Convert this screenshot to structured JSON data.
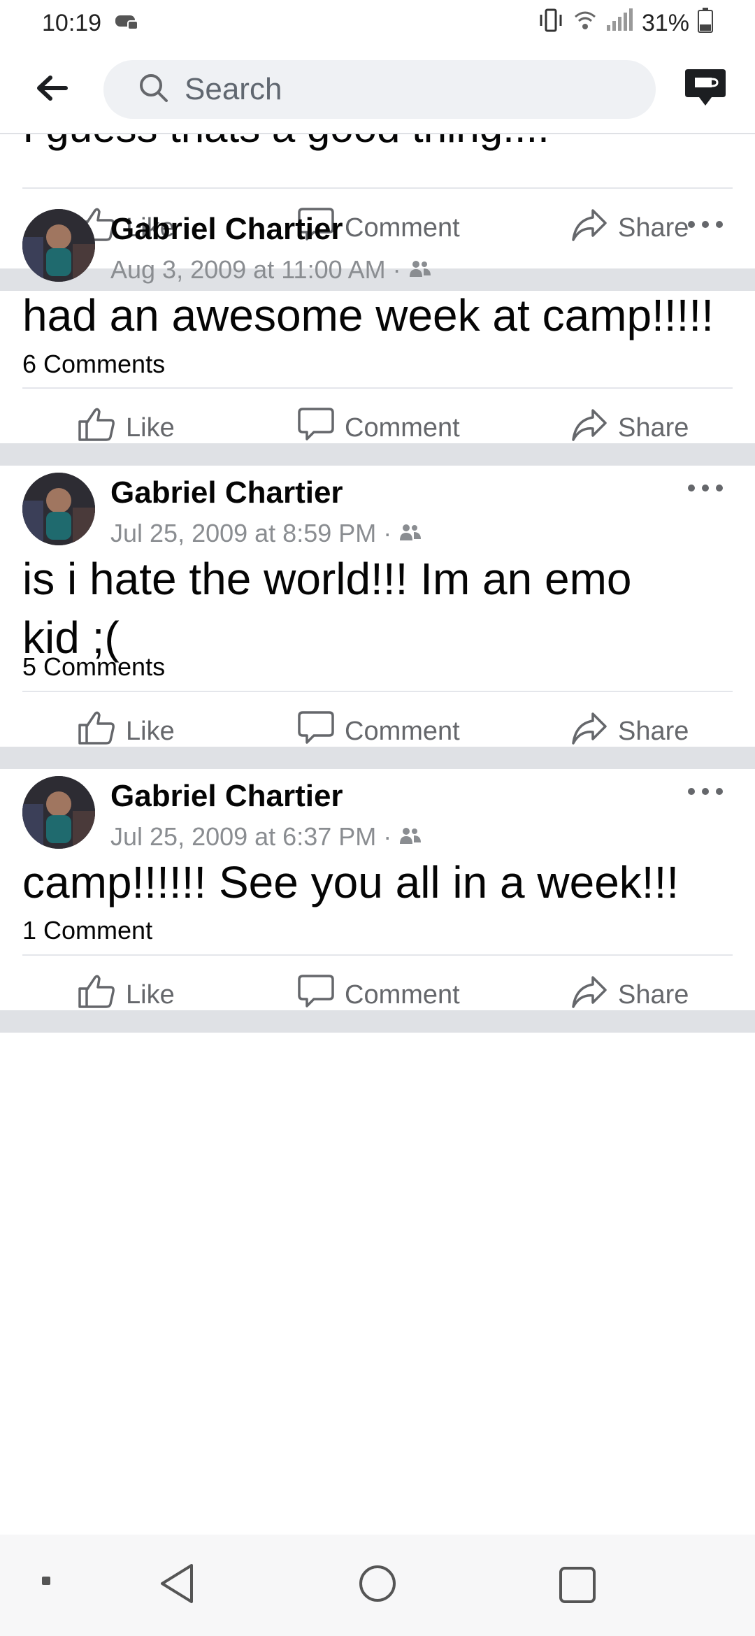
{
  "status_bar": {
    "time": "10:19",
    "battery": "31%"
  },
  "header": {
    "search_placeholder": "Search"
  },
  "feed": {
    "partial_text": "I guess thats a good thing...."
  },
  "actions": {
    "like": "Like",
    "comment": "Comment",
    "share": "Share"
  },
  "posts": [
    {
      "author": "Gabriel Chartier",
      "timestamp": "Aug 3, 2009 at 11:00 AM",
      "text_lines": [
        "had an awesome week at camp!!!!!"
      ],
      "comments": "6 Comments"
    },
    {
      "author": "Gabriel Chartier",
      "timestamp": "Jul 25, 2009 at 8:59 PM",
      "text_lines": [
        "is i hate the world!!! Im an emo",
        "kid ;("
      ],
      "comments": "5 Comments"
    },
    {
      "author": "Gabriel Chartier",
      "timestamp": "Jul 25, 2009 at 6:37 PM",
      "text_lines": [
        "camp!!!!!! See you all in a week!!!"
      ],
      "comments": "1 Comment"
    }
  ],
  "icons": {
    "back": "back-arrow-icon",
    "search": "search-icon",
    "messenger": "messenger-icon",
    "like": "thumbs-up-icon",
    "comment": "comment-bubble-icon",
    "share": "share-arrow-icon",
    "audience": "friends-icon",
    "more": "more-dots-icon"
  }
}
